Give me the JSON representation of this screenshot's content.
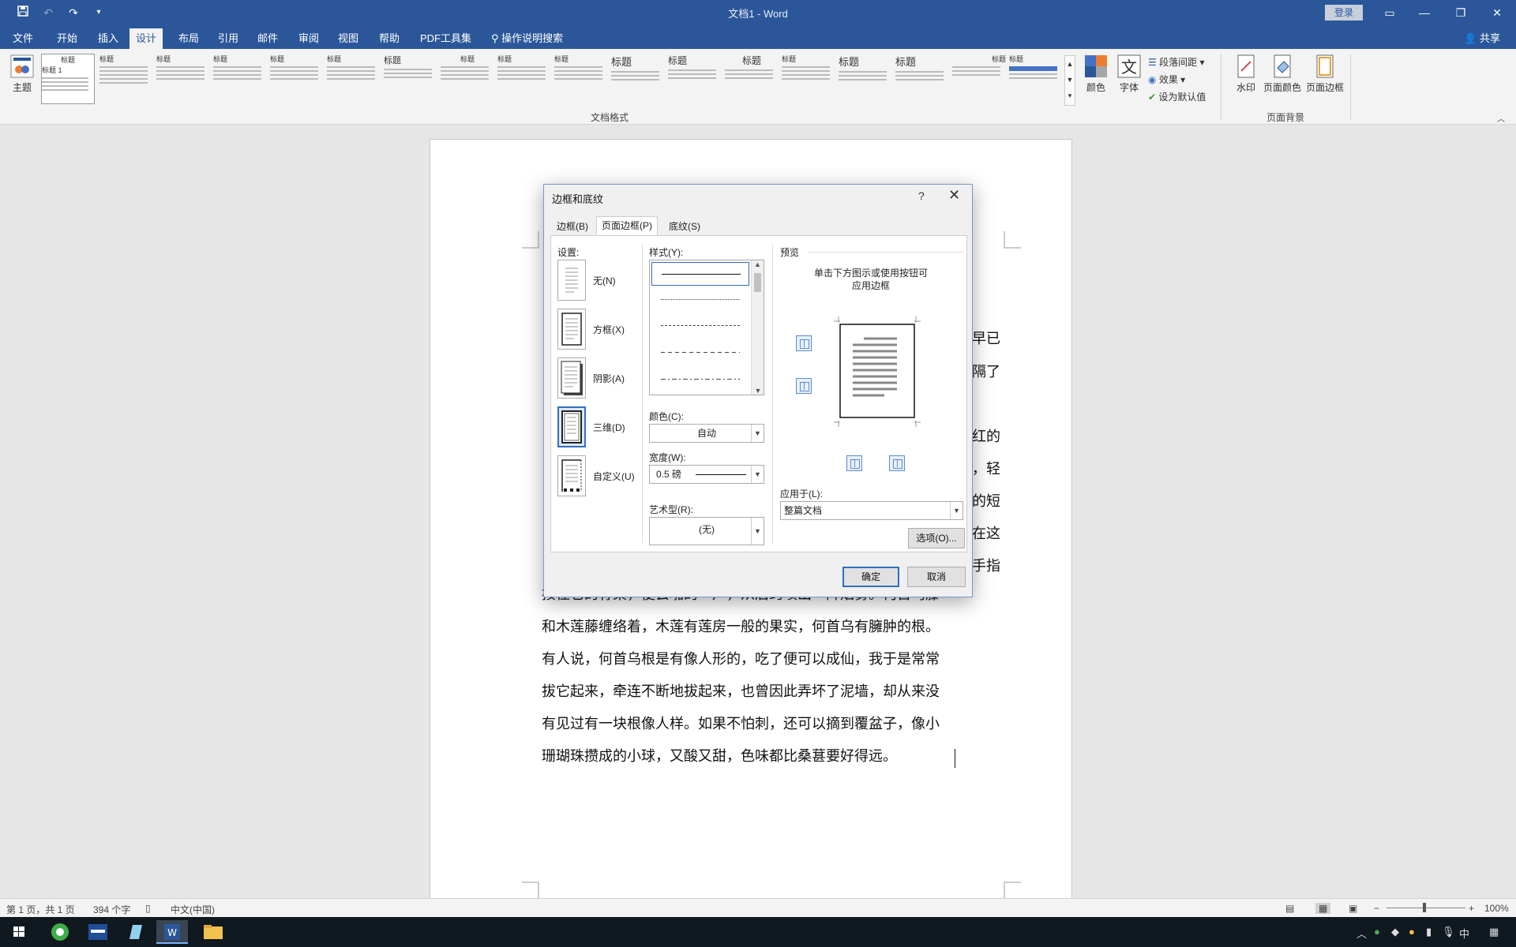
{
  "window": {
    "title": "文档1  -  Word",
    "login_label": "登录",
    "share_label": "共享"
  },
  "menu": {
    "tabs": [
      "文件",
      "开始",
      "插入",
      "设计",
      "布局",
      "引用",
      "邮件",
      "审阅",
      "视图",
      "帮助",
      "PDF工具集"
    ],
    "active_tab": "设计",
    "search_label": "操作说明搜索"
  },
  "ribbon": {
    "theme_label": "主题",
    "gallery_group_label": "文档格式",
    "style_thumb_title": "标题",
    "style_thumb_title_1": "标题 1",
    "colors_label": "颜色",
    "fonts_label": "字体",
    "paragraph_spacing_label": "段落间距",
    "effects_label": "效果",
    "set_default_label": "设为默认值",
    "watermark_label": "水印",
    "page_color_label": "页面颜色",
    "page_borders_label": "页面边框",
    "page_background_group_label": "页面背景"
  },
  "document": {
    "right_edge_chars": [
      "早已",
      "隔了",
      "红的",
      "，轻",
      "的短",
      "在这",
      "手指"
    ],
    "partial_line": "按住它的脊梁，便会啪的一声，从后窍喷出一阵烟雾。何首乌藤",
    "lines": [
      "和木莲藤缠络着，木莲有莲房一般的果实，何首乌有臃肿的根。",
      "有人说，何首乌根是有像人形的，吃了便可以成仙，我于是常常",
      "拔它起来，牵连不断地拔起来，也曾因此弄坏了泥墙，却从来没",
      "有见过有一块根像人样。如果不怕刺，还可以摘到覆盆子，像小",
      "珊瑚珠攒成的小球，又酸又甜，色味都比桑葚要好得远。"
    ]
  },
  "statusbar": {
    "page_info": "第 1 页，共 1 页",
    "word_count": "394 个字",
    "language": "中文(中国)",
    "zoom": "100%"
  },
  "dialog": {
    "title": "边框和底纹",
    "help": "?",
    "tabs": [
      "边框(B)",
      "页面边框(P)",
      "底纹(S)"
    ],
    "active_tab": "页面边框(P)",
    "settings_label": "设置:",
    "settings": [
      "无(N)",
      "方框(X)",
      "阴影(A)",
      "三维(D)",
      "自定义(U)"
    ],
    "selected_setting": "三维(D)",
    "style_label": "样式(Y):",
    "color_label": "颜色(C):",
    "color_value": "自动",
    "width_label": "宽度(W):",
    "width_value": "0.5 磅",
    "art_label": "艺术型(R):",
    "art_value": "(无)",
    "preview_label": "预览",
    "preview_hint_1": "单击下方图示或使用按钮可",
    "preview_hint_2": "应用边框",
    "apply_to_label": "应用于(L):",
    "apply_to_value": "整篇文档",
    "options_button": "选项(O)...",
    "ok_button": "确定",
    "cancel_button": "取消"
  },
  "colors": {
    "accent": "#2b579a",
    "dialog_border": "#7a9ac9",
    "selected_blue": "#2f6fbf"
  }
}
